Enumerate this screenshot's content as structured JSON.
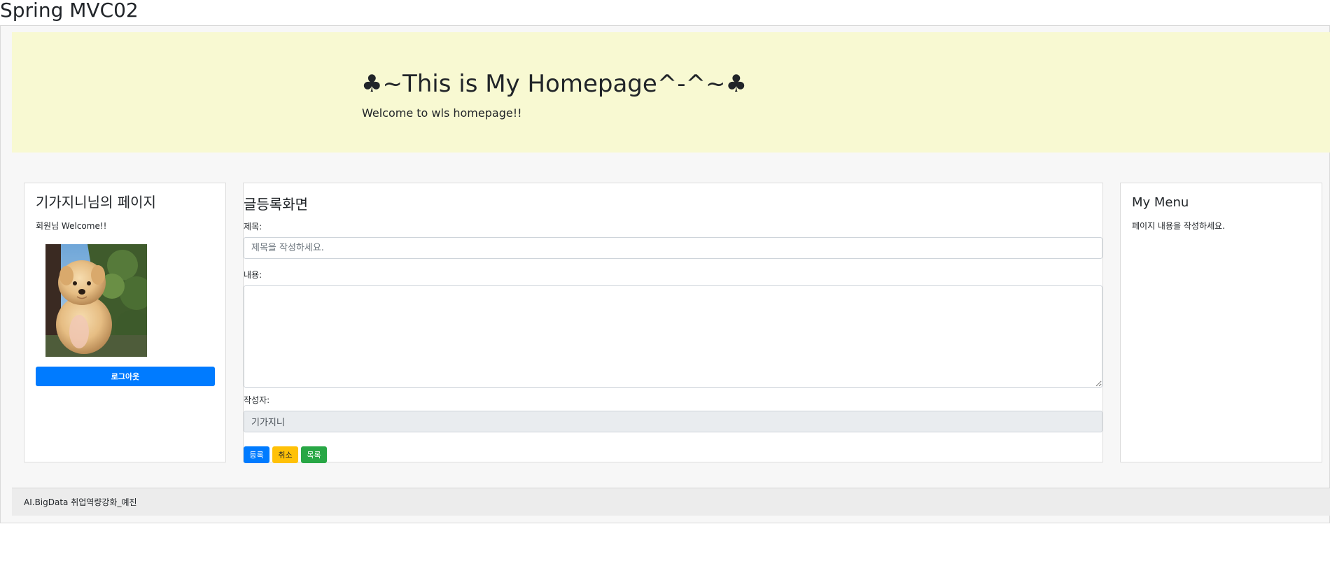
{
  "app_title": "Spring MVC02",
  "header": {
    "title": "♣~This is My Homepage^-^~♣",
    "subtitle": "Welcome to wls homepage!!"
  },
  "left_panel": {
    "title": "기가지니님의 페이지",
    "welcome": "회원님 Welcome!!",
    "avatar_alt": "puppy photo",
    "logout_label": "로그아웃"
  },
  "form": {
    "title": "글등록화면",
    "title_label": "제목:",
    "title_placeholder": "제목을 작성하세요.",
    "content_label": "내용:",
    "content_value": "",
    "writer_label": "작성자:",
    "writer_value": "기가지니",
    "submit_label": "등록",
    "cancel_label": "취소",
    "list_label": "목록"
  },
  "right_panel": {
    "title": "My Menu",
    "text": "페이지 내용을 작성하세요."
  },
  "footer": {
    "text": "AI.BigData 취업역량강화_예진"
  },
  "colors": {
    "jumbotron_bg": "#f8f9d2",
    "primary": "#007bff",
    "warning": "#ffc107",
    "success": "#28a745"
  }
}
